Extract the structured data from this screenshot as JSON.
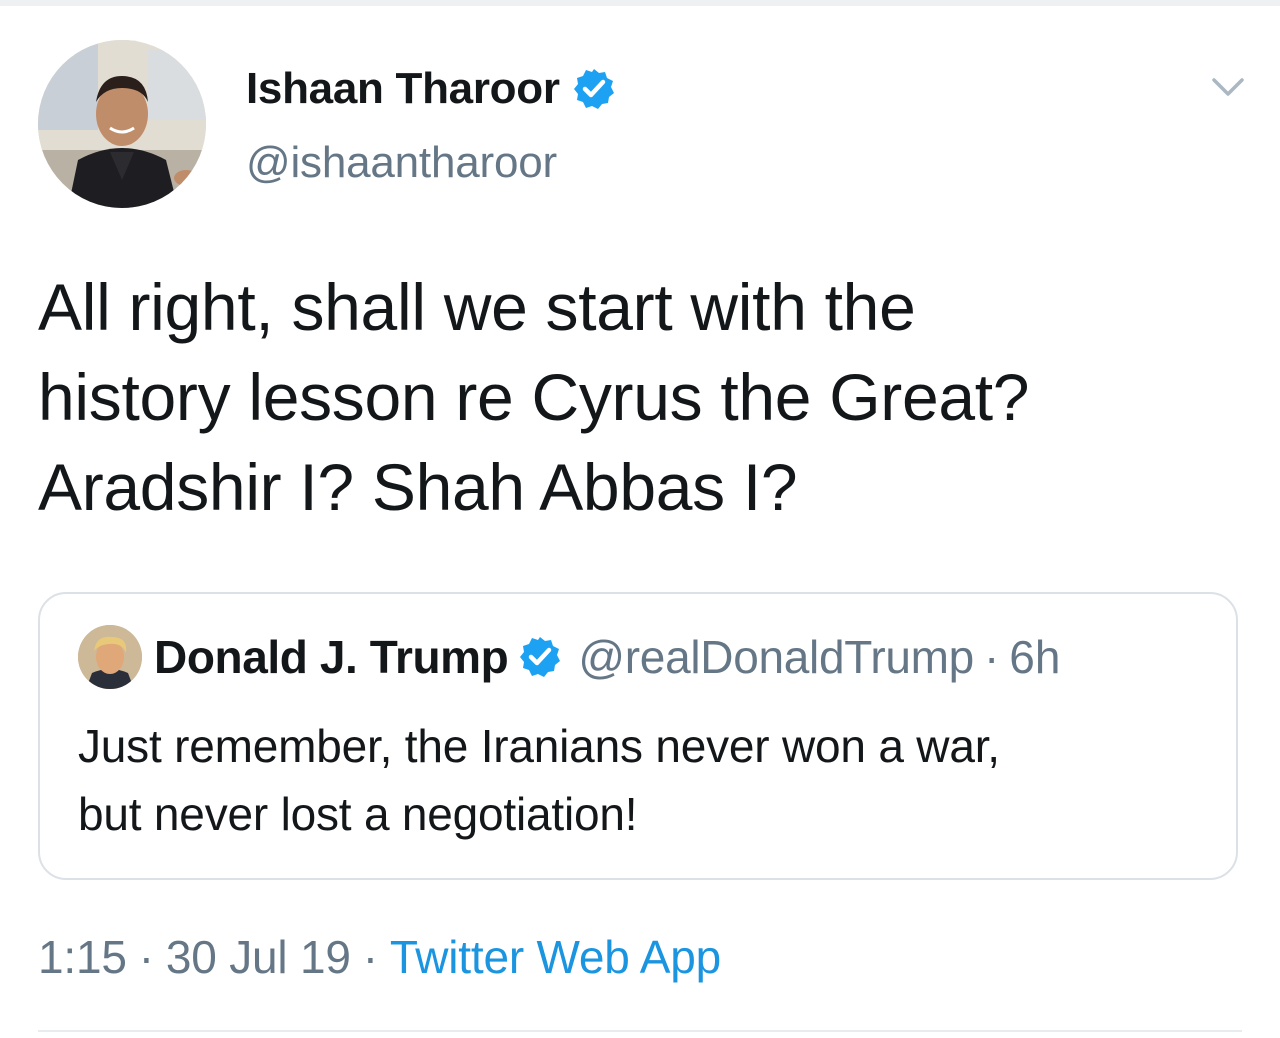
{
  "tweet": {
    "author": {
      "name": "Ishaan Tharoor",
      "handle": "@ishaantharoor",
      "verified": true,
      "avatar_icon": "person-photo-avatar"
    },
    "text_lines": [
      "All right, shall we start with the",
      "history lesson re Cyrus the Great?",
      "Aradshir I? Shah Abbas I?"
    ],
    "menu_icon": "chevron-down-icon",
    "quoted_tweet": {
      "author_name": "Donald J. Trump",
      "verified": true,
      "handle": "@realDonaldTrump",
      "separator": "·",
      "time": "6h",
      "text_lines": [
        "Just remember, the Iranians never won a war,",
        "but never lost a negotiation!"
      ]
    },
    "meta": {
      "time": "1:15",
      "separator": "·",
      "date": "30 Jul 19",
      "source": "Twitter Web App"
    }
  },
  "colors": {
    "text_primary": "#14171a",
    "text_secondary": "#657786",
    "link_blue": "#1b95e0",
    "verified_blue": "#1da1f2",
    "border": "#dbe1e6"
  }
}
